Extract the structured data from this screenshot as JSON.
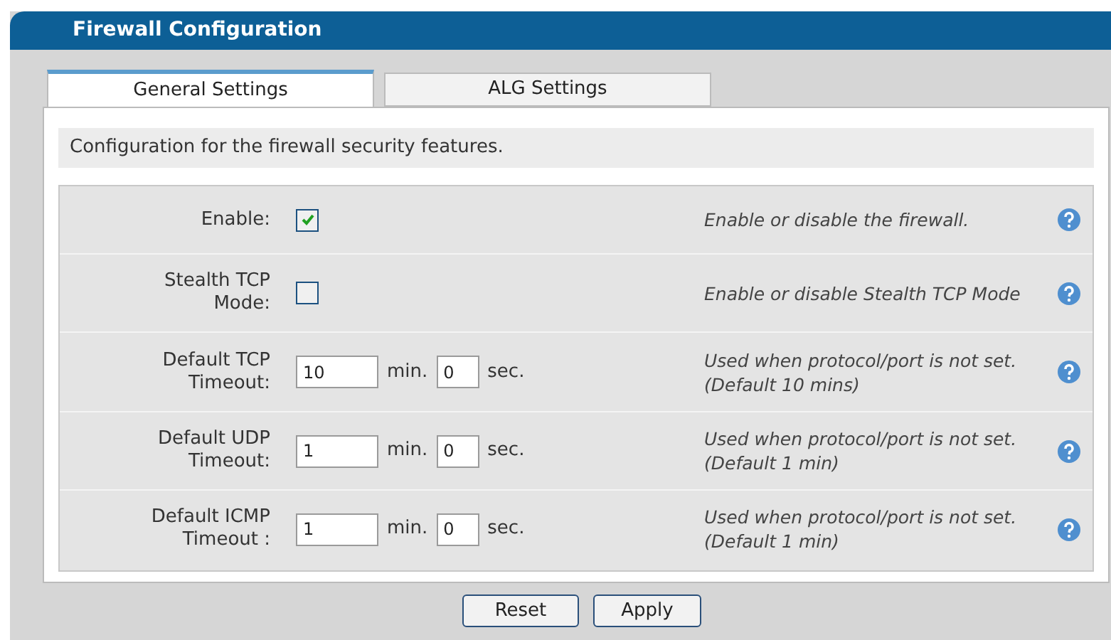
{
  "window": {
    "title": "Firewall Configuration"
  },
  "tabs": [
    {
      "label": "General Settings",
      "selected": true
    },
    {
      "label": "ALG Settings",
      "selected": false
    }
  ],
  "description": "Configuration for the firewall security features.",
  "rows": [
    {
      "kind": "checkbox",
      "label": "Enable:",
      "checked": true,
      "help": "Enable or disable the firewall."
    },
    {
      "kind": "checkbox",
      "label": "Stealth TCP Mode:",
      "checked": false,
      "help": "Enable or disable Stealth TCP Mode"
    },
    {
      "kind": "timeout",
      "label": "Default TCP Timeout:",
      "minutes": "10",
      "min_unit": "min.",
      "seconds": "0",
      "sec_unit": "sec.",
      "help": "Used when protocol/port is not set. (Default 10 mins)"
    },
    {
      "kind": "timeout",
      "label": "Default UDP Timeout:",
      "minutes": "1",
      "min_unit": "min.",
      "seconds": "0",
      "sec_unit": "sec.",
      "help": "Used when protocol/port is not set. (Default 1 min)"
    },
    {
      "kind": "timeout",
      "label": "Default ICMP Timeout :",
      "minutes": "1",
      "min_unit": "min.",
      "seconds": "0",
      "sec_unit": "sec.",
      "help": "Used when protocol/port is not set. (Default 1 min)"
    }
  ],
  "buttons": [
    "Reset",
    "Apply"
  ]
}
